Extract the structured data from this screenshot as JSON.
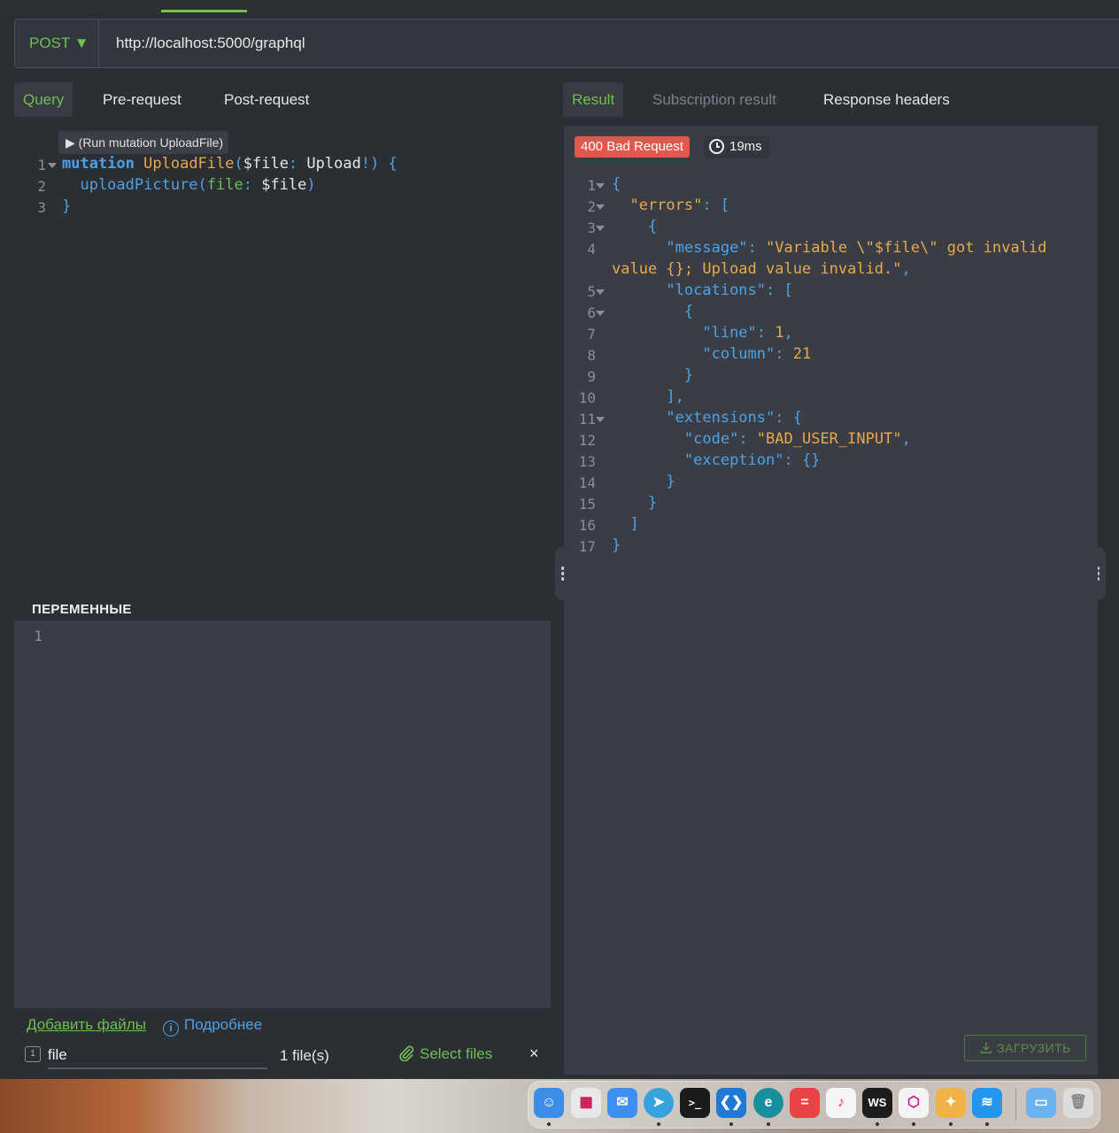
{
  "request": {
    "method": "POST ▼",
    "url": "http://localhost:5000/graphql"
  },
  "left_tabs": [
    "Query",
    "Pre-request",
    "Post-request"
  ],
  "right_tabs": [
    "Result",
    "Subscription result",
    "Response headers"
  ],
  "query": {
    "run_label": "▶ (Run mutation UploadFile)",
    "line_numbers": [
      "1",
      "2",
      "3"
    ],
    "code": {
      "l1_keyword": "mutation",
      "l1_name": "UploadFile",
      "l1_open": "(",
      "l1_var": "$file",
      "l1_colon": ": ",
      "l1_type": "Upload",
      "l1_bang": "!) {",
      "l2_field": "  uploadPicture(",
      "l2_arg": "file",
      "l2_colon": ": ",
      "l2_var": "$file",
      "l2_close": ")",
      "l3": "}"
    }
  },
  "variables": {
    "title": "ПЕРЕМЕННЫЕ",
    "line_number": "1"
  },
  "upload": {
    "add_files": "Добавить файлы",
    "more": "Подробнее",
    "info_glyph": "i",
    "index": "1",
    "file_name": "file",
    "file_count": "1 file(s)",
    "select_files": "Select files",
    "close": "×"
  },
  "result": {
    "status": "400 Bad Request",
    "time": "19ms",
    "line_numbers": [
      "1",
      "2",
      "3",
      "4",
      "5",
      "6",
      "7",
      "8",
      "9",
      "10",
      "11",
      "12",
      "13",
      "14",
      "15",
      "16",
      "17"
    ],
    "json": {
      "l1": "{",
      "l2_key": "\"errors\"",
      "l2_rest": ": [",
      "l3": "{",
      "l4_key": "\"message\"",
      "l4_colon": ": ",
      "l4_val": "\"Variable \\\"$file\\\" got invalid",
      "l4b_val": "value {}; Upload value invalid.\"",
      "l4b_comma": ",",
      "l5_key": "\"locations\"",
      "l5_rest": ": [",
      "l6": "{",
      "l7_key": "\"line\"",
      "l7_colon": ": ",
      "l7_val": "1",
      "l7_comma": ",",
      "l8_key": "\"column\"",
      "l8_colon": ": ",
      "l8_val": "21",
      "l9": "}",
      "l10": "],",
      "l11_key": "\"extensions\"",
      "l11_rest": ": {",
      "l12_key": "\"code\"",
      "l12_colon": ": ",
      "l12_val": "\"BAD_USER_INPUT\"",
      "l12_comma": ",",
      "l13_key": "\"exception\"",
      "l13_rest": ": {}",
      "l14": "}",
      "l15": "}",
      "l16": "]",
      "l17": "}"
    },
    "download": "ЗАГРУЗИТЬ"
  },
  "dock": {
    "apps": [
      "finder-icon",
      "launchpad-icon",
      "mail-icon",
      "telegram-icon",
      "terminal-icon",
      "vscode-icon",
      "edge-icon",
      "calculator-icon",
      "music-icon",
      "webstorm-icon",
      "graphql-icon",
      "altair-icon",
      "docker-icon",
      "folder-icon",
      "trash-icon"
    ],
    "labels": {
      "terminal": ">_",
      "webstorm": "WS",
      "calculator": "="
    },
    "colors": {
      "finder": "#3b8ee8",
      "launchpad": "#e8e8ec",
      "mail": "#3d8ff0",
      "telegram": "#36a3de",
      "terminal": "#1b1b1b",
      "vscode": "#1f7ad6",
      "edge": "#1a8f9c",
      "calculator": "#e94444",
      "music": "#f5f5f5",
      "webstorm": "#1c1c1c",
      "graphql": "#f4f4f4",
      "altair": "#f2b24a",
      "docker": "#2496ed",
      "folder": "#6bb3f0",
      "trash": "#dcdcdc"
    }
  },
  "colors": {
    "accent_green": "#6fbf54",
    "keyword_blue": "#4da1e6",
    "string_orange": "#e8a84c",
    "error_red": "#e3584d"
  }
}
